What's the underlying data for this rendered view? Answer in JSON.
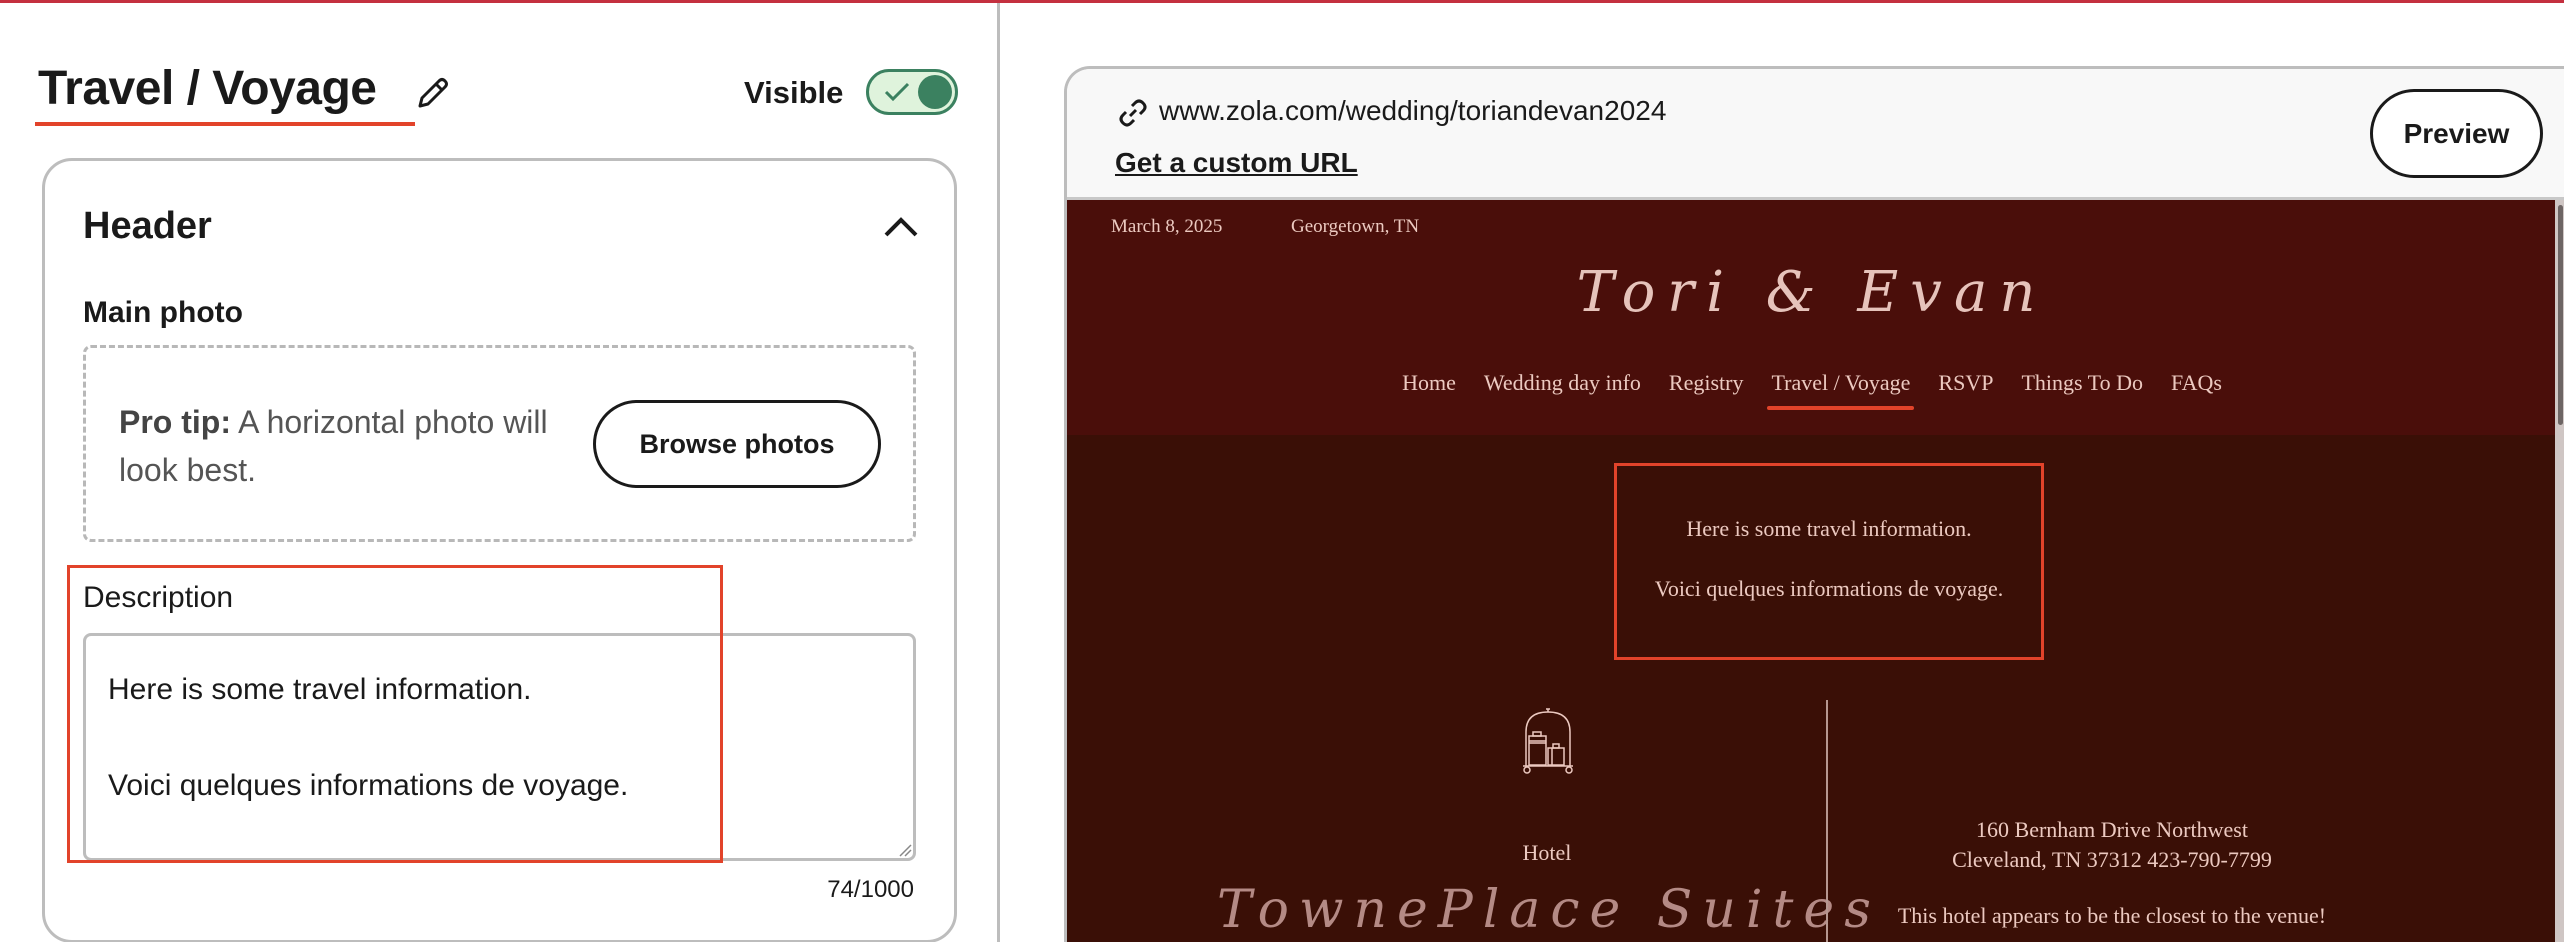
{
  "editor": {
    "page_title": "Travel / Voyage",
    "visible_label": "Visible",
    "visible_on": true,
    "section": {
      "title": "Header",
      "expanded": true,
      "main_photo_label": "Main photo",
      "pro_tip_bold": "Pro tip:",
      "pro_tip_text": " A horizontal photo will look best.",
      "browse_button": "Browse photos",
      "description_label": "Description",
      "description_value": "Here is some travel information.\n\nVoici quelques informations de voyage.",
      "char_count": "74/1000"
    }
  },
  "preview": {
    "url": "www.zola.com/wedding/toriandevan2024",
    "custom_url_link": "Get a custom URL",
    "preview_button": "Preview",
    "site": {
      "date": "March 8, 2025",
      "location": "Georgetown, TN",
      "couple_names": "Tori & Evan",
      "nav": [
        {
          "label": "Home",
          "active": false
        },
        {
          "label": "Wedding day info",
          "active": false
        },
        {
          "label": "Registry",
          "active": false
        },
        {
          "label": "Travel / Voyage",
          "active": true
        },
        {
          "label": "RSVP",
          "active": false
        },
        {
          "label": "Things To Do",
          "active": false
        },
        {
          "label": "FAQs",
          "active": false
        }
      ],
      "description_lines": [
        "Here is some travel information.",
        "Voici quelques informations de voyage."
      ],
      "hotel": {
        "icon": "luggage-cart-icon",
        "type": "Hotel",
        "name": "TownePlace Suites",
        "address_line1": "160 Bernham Drive Northwest",
        "address_line2": "Cleveland, TN 37312 423-790-7799",
        "note": "This hotel appears to be the closest to the venue!"
      }
    }
  },
  "colors": {
    "accent_red": "#e2432a",
    "toggle_green": "#3b8160",
    "site_header_bg": "#4a0e0a",
    "site_body_bg": "#3a0f06",
    "site_text": "#ecc9c0"
  }
}
